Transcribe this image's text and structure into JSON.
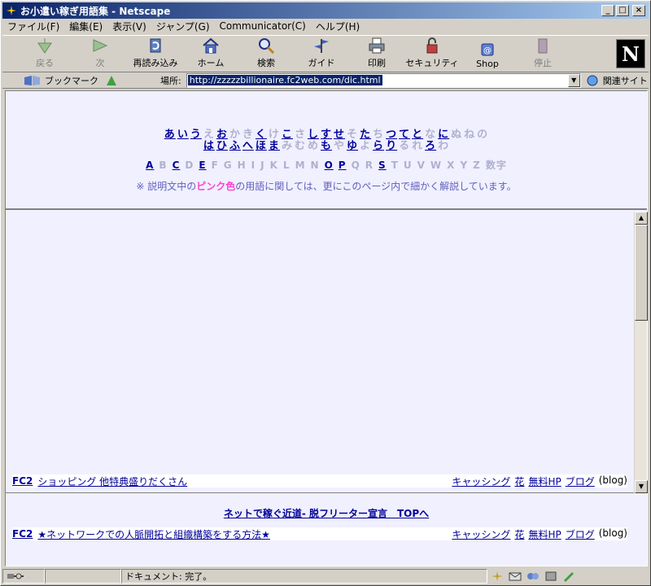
{
  "window": {
    "title": "お小遣い稼ぎ用語集 - Netscape"
  },
  "menu": [
    "ファイル(F)",
    "編集(E)",
    "表示(V)",
    "ジャンプ(G)",
    "Communicator(C)",
    "ヘルプ(H)"
  ],
  "toolbar": {
    "back": "戻る",
    "forward": "次",
    "reload": "再読み込み",
    "home": "ホーム",
    "search": "検索",
    "guide": "ガイド",
    "print": "印刷",
    "security": "セキュリティ",
    "shop": "Shop",
    "stop": "停止"
  },
  "logo": "N",
  "location": {
    "bookmarks": "ブックマーク",
    "label": "場所:",
    "url": "http://zzzzzbillionaire.fc2web.com/dic.html",
    "related": "関連サイト"
  },
  "kana_rows": [
    [
      [
        "あ",
        1
      ],
      [
        "い",
        1
      ],
      [
        "う",
        1
      ],
      [
        "え",
        0
      ],
      [
        "お",
        1
      ],
      [
        "か",
        0
      ],
      [
        "き",
        0
      ],
      [
        "く",
        1
      ],
      [
        "け",
        0
      ],
      [
        "こ",
        1
      ],
      [
        "さ",
        0
      ],
      [
        "し",
        1
      ],
      [
        "す",
        1
      ],
      [
        "せ",
        1
      ],
      [
        "そ",
        0
      ],
      [
        "た",
        1
      ],
      [
        "ち",
        0
      ],
      [
        "つ",
        1
      ],
      [
        "て",
        1
      ],
      [
        "と",
        1
      ],
      [
        "な",
        0
      ],
      [
        "に",
        1
      ],
      [
        "ぬ",
        0
      ],
      [
        "ね",
        0
      ],
      [
        "の",
        0
      ]
    ],
    [
      [
        "は",
        1
      ],
      [
        "ひ",
        1
      ],
      [
        "ふ",
        1
      ],
      [
        "へ",
        1
      ],
      [
        "ほ",
        1
      ],
      [
        "ま",
        1
      ],
      [
        "み",
        0
      ],
      [
        "む",
        0
      ],
      [
        "め",
        0
      ],
      [
        "も",
        1
      ],
      [
        "や",
        0
      ],
      [
        "ゆ",
        1
      ],
      [
        "よ",
        0
      ],
      [
        "ら",
        1
      ],
      [
        "り",
        1
      ],
      [
        "る",
        0
      ],
      [
        "れ",
        0
      ],
      [
        "ろ",
        1
      ],
      [
        "わ",
        0
      ]
    ]
  ],
  "alpha_row": [
    [
      "A",
      1
    ],
    [
      "B",
      0
    ],
    [
      "C",
      1
    ],
    [
      "D",
      0
    ],
    [
      "E",
      1
    ],
    [
      "F",
      0
    ],
    [
      "G",
      0
    ],
    [
      "H",
      0
    ],
    [
      "I",
      0
    ],
    [
      "J",
      0
    ],
    [
      "K",
      0
    ],
    [
      "L",
      0
    ],
    [
      "M",
      0
    ],
    [
      "N",
      0
    ],
    [
      "O",
      1
    ],
    [
      "P",
      1
    ],
    [
      "Q",
      0
    ],
    [
      "R",
      0
    ],
    [
      "S",
      1
    ],
    [
      "T",
      0
    ],
    [
      "U",
      0
    ],
    [
      "V",
      0
    ],
    [
      "W",
      0
    ],
    [
      "X",
      0
    ],
    [
      "Y",
      0
    ],
    [
      "Z",
      0
    ],
    [
      "数字",
      0
    ]
  ],
  "note": {
    "pre": "※ 説明文中の",
    "pink": "ピンク色",
    "post": "の用語に関しては、更にこのページ内で細かく解説しています。"
  },
  "ad1": {
    "fc2": "FC2",
    "main": "ショッピング 他特典盛りだくさん",
    "links": [
      "キャッシング",
      "花",
      "無料HP",
      "ブログ"
    ],
    "paren": "(blog)"
  },
  "top_link": "ネットで稼ぐ近道- 脱フリーター宣言　TOPへ",
  "ad2": {
    "fc2": "FC2",
    "main": "★ネットワークでの人脈開拓と組織構築をする方法★",
    "links": [
      "キャッシング",
      "花",
      "無料HP",
      "ブログ"
    ],
    "paren": "(blog)"
  },
  "status": {
    "text": "ドキュメント: 完了。"
  },
  "colors": {
    "link": "#000099",
    "pink": "#ff44cc",
    "bg": "#f0f0ff"
  }
}
